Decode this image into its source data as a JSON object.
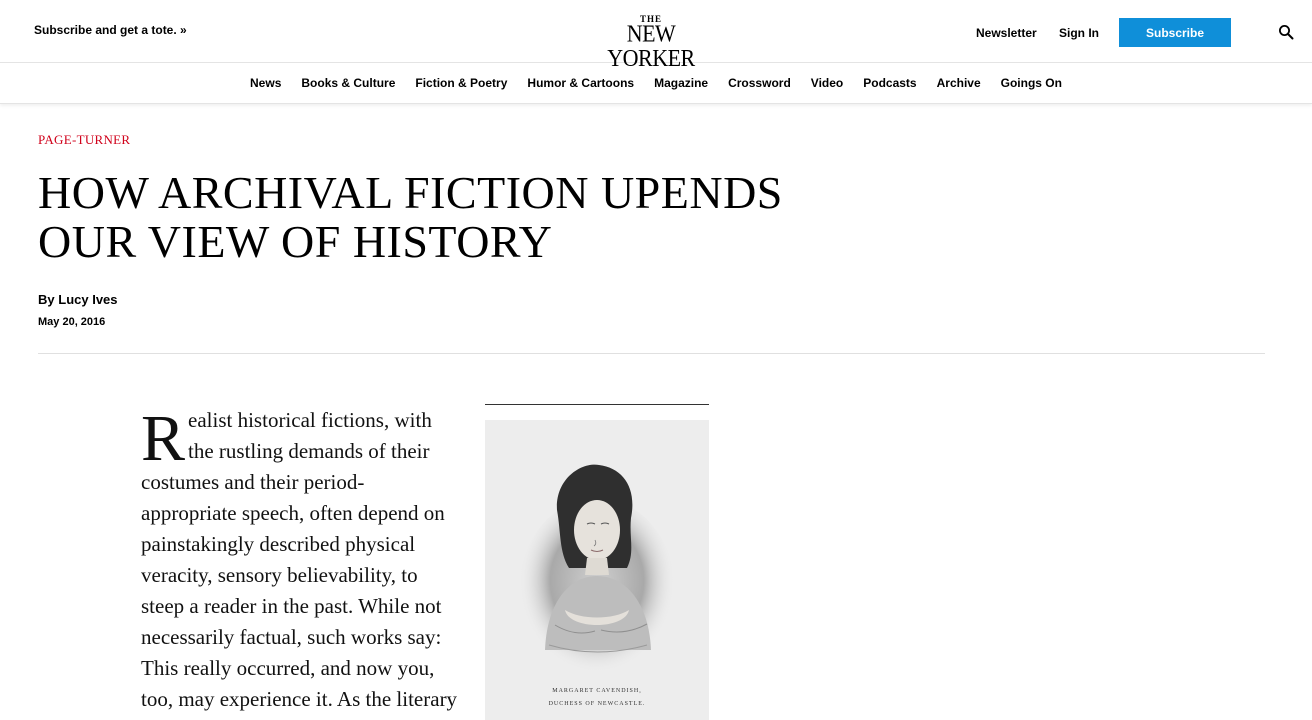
{
  "header": {
    "promo": "Subscribe and get a tote. »",
    "logo_the": "THE",
    "logo_main": "NEW YORKER",
    "newsletter": "Newsletter",
    "sign_in": "Sign In",
    "subscribe": "Subscribe",
    "search_icon": "search-icon"
  },
  "nav": {
    "items": [
      "News",
      "Books & Culture",
      "Fiction & Poetry",
      "Humor & Cartoons",
      "Magazine",
      "Crossword",
      "Video",
      "Podcasts",
      "Archive",
      "Goings On"
    ]
  },
  "article": {
    "rubric": "PAGE-TURNER",
    "title": "HOW ARCHIVAL FICTION UPENDS OUR VIEW OF HISTORY",
    "byline_prefix": "By",
    "author": "Lucy Ives",
    "date": "May 20, 2016",
    "dropcap": "R",
    "body": "ealist historical fictions, with the rustling demands of their costumes and their period-appropriate speech, often depend on painstakingly described physical veracity, sensory believability, to steep a reader in the past. While not necessarily factual, such works say: This really occurred, and now you, too, may experience it. As the literary"
  },
  "figure": {
    "caption_line1": "MARGARET CAVENDISH,",
    "caption_line2": "DUCHESS OF NEWCASTLE."
  },
  "colors": {
    "accent_red": "#d0021b",
    "subscribe_blue": "#0f8fd9"
  }
}
